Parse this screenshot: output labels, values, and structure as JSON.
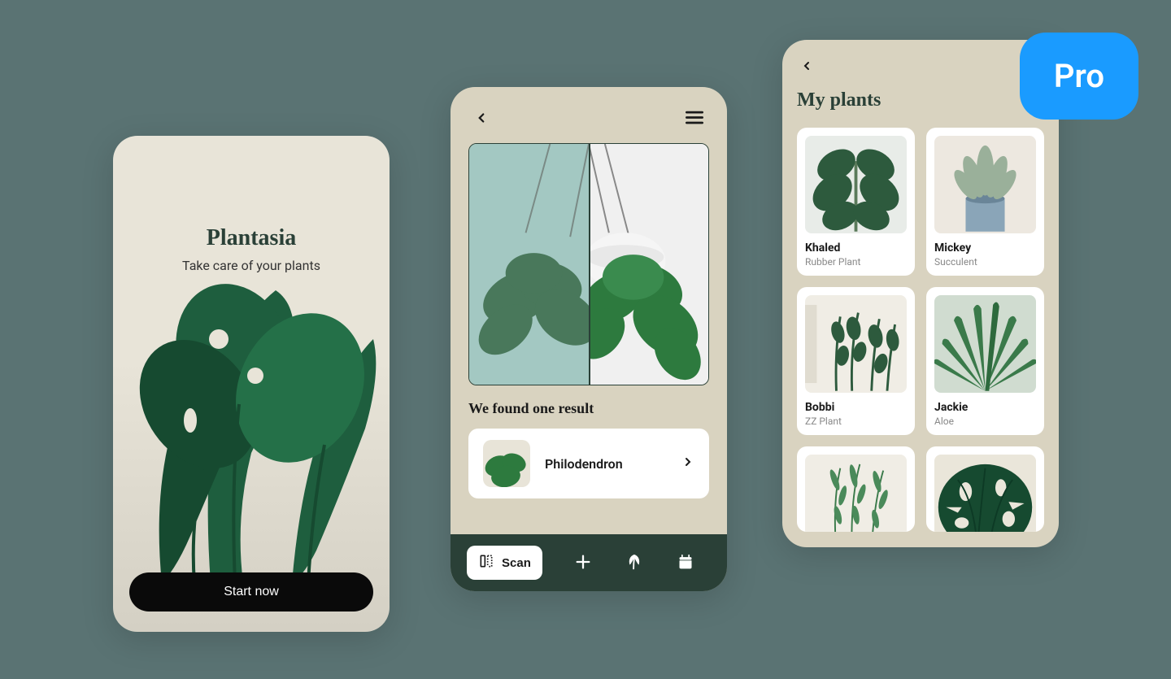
{
  "onboarding": {
    "brand": "Plantasia",
    "tagline": "Take care of your plants",
    "cta": "Start now"
  },
  "scan": {
    "result_title": "We found one result",
    "result_name": "Philodendron",
    "nav": {
      "scan_label": "Scan"
    }
  },
  "my_plants": {
    "title": "My plants",
    "items": [
      {
        "name": "Khaled",
        "type": "Rubber Plant"
      },
      {
        "name": "Mickey",
        "type": "Succulent"
      },
      {
        "name": "Bobbi",
        "type": "ZZ Plant"
      },
      {
        "name": "Jackie",
        "type": "Aloe"
      }
    ]
  },
  "badge": {
    "label": "Pro"
  },
  "colors": {
    "bg": "#5a7373",
    "phone_bg": "#d9d3c0",
    "dark_green": "#2a4037",
    "accent_blue": "#1a9bff"
  }
}
